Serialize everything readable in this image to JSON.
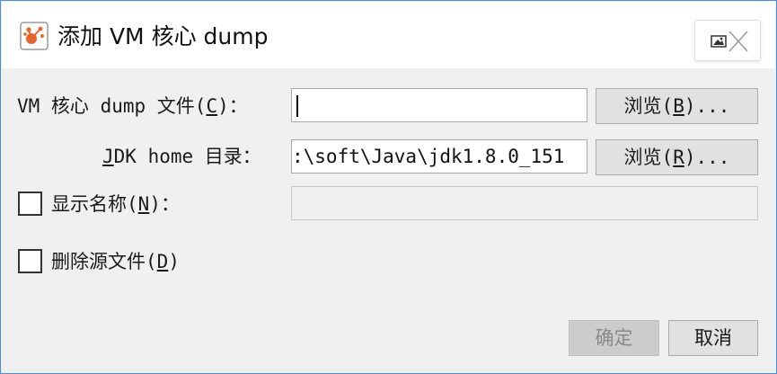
{
  "window": {
    "title": "添加 VM 核心 dump",
    "accent_color": "#4a8fd8",
    "icon": "app-logo-icon",
    "close_icon": "close-icon"
  },
  "form": {
    "dump_file": {
      "label_prefix": "VM 核心 dump 文件(",
      "label_mnemonic": "C",
      "label_suffix": ")：",
      "value": "",
      "browse": {
        "prefix": "浏览(",
        "mnemonic": "B",
        "suffix": ")..."
      }
    },
    "jdk_home": {
      "label_mnemonic": "J",
      "label_rest": "DK home 目录：",
      "value": ":\\soft\\Java\\jdk1.8.0_151",
      "browse": {
        "prefix": "浏览(",
        "mnemonic": "R",
        "suffix": ")..."
      }
    },
    "display_name": {
      "label_prefix": "显示名称(",
      "label_mnemonic": "N",
      "label_suffix": ")：",
      "checked": false,
      "value": "",
      "enabled": false
    },
    "delete_source": {
      "label_prefix": "删除源文件(",
      "label_mnemonic": "D",
      "label_suffix": ")",
      "checked": false
    }
  },
  "buttons": {
    "ok": {
      "label": "确定",
      "enabled": false
    },
    "cancel": {
      "label": "取消",
      "enabled": true
    }
  }
}
